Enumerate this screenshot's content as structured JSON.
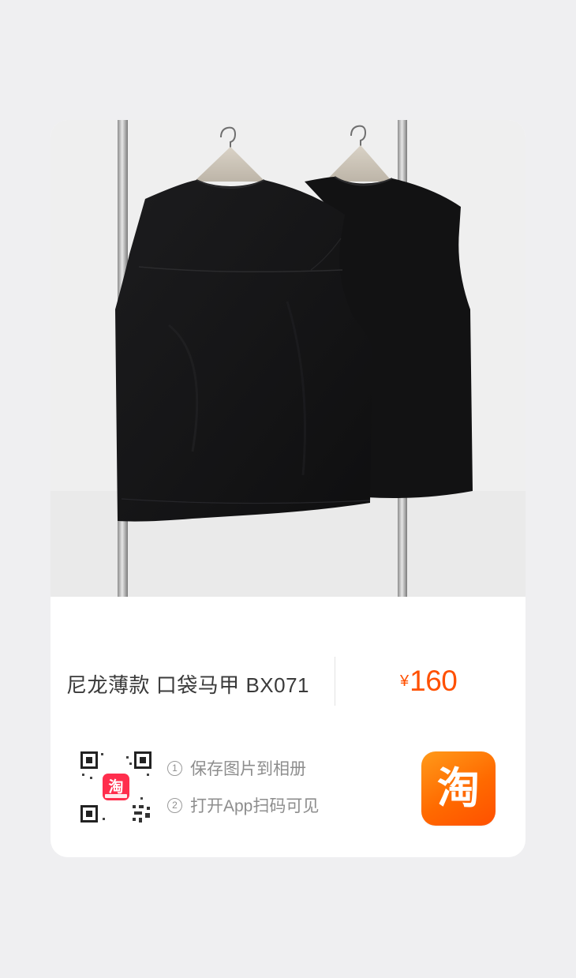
{
  "product": {
    "title": "尼龙薄款 口袋马甲 BX071",
    "currency_symbol": "¥",
    "price": "160",
    "image_icon": "product-photo-vests-on-rack"
  },
  "qr": {
    "center_badge_text": "淘"
  },
  "steps": [
    {
      "num": "1",
      "text": "保存图片到相册"
    },
    {
      "num": "2",
      "text": "打开App扫码可见"
    }
  ],
  "app_button": {
    "glyph": "淘",
    "icon": "taobao-app-icon"
  },
  "colors": {
    "price": "#ff5000",
    "brand_orange": "#ff6a00",
    "page_bg": "#efeff1",
    "card_bg": "#ffffff"
  }
}
